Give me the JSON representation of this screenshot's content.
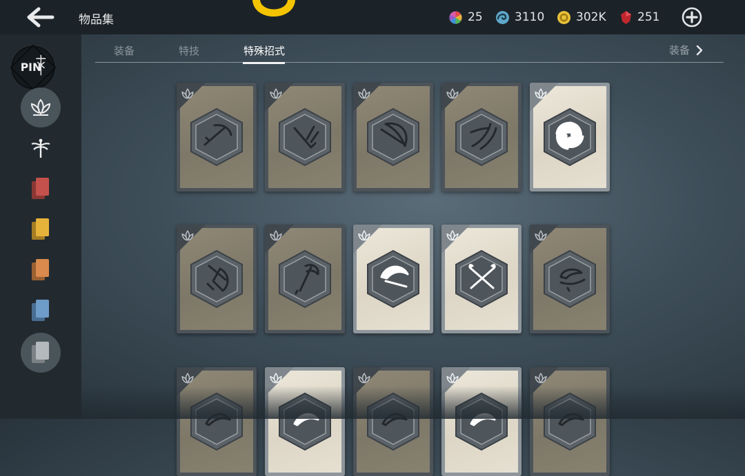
{
  "header": {
    "title": "物品集",
    "back_icon": "back-arrow-icon",
    "emblem_icon": "gold-emblem-icon",
    "resources": [
      {
        "name": "prism",
        "icon": "rainbow-orb-icon",
        "value": "25"
      },
      {
        "name": "spirit",
        "icon": "blue-swirl-icon",
        "value": "3110"
      },
      {
        "name": "coins",
        "icon": "gold-coin-icon",
        "value": "302K"
      },
      {
        "name": "gems",
        "icon": "red-gem-icon",
        "value": "251"
      }
    ],
    "add_icon": "plus-circle-icon"
  },
  "sidebar": {
    "items": [
      {
        "icon": "pin-badge-icon",
        "label": "PIN"
      },
      {
        "icon": "lotus-icon",
        "active": true
      },
      {
        "icon": "dragonfly-icon"
      },
      {
        "icon": "red-cards-icon",
        "color": "#c4514c"
      },
      {
        "icon": "yellow-cards-icon",
        "color": "#e6b33a"
      },
      {
        "icon": "orange-cards-icon",
        "color": "#d98a4c"
      },
      {
        "icon": "blue-cards-icon",
        "color": "#6e9cc9"
      },
      {
        "icon": "gray-cards-icon",
        "color": "#b4b9bd"
      }
    ]
  },
  "tabs": {
    "items": [
      "装备",
      "特技",
      "特殊招式"
    ],
    "selected": "特殊招式",
    "next_label": "装备"
  },
  "cards": [
    {
      "icon": "curved-blade-icon",
      "owned": false
    },
    {
      "icon": "knife-slash-icon",
      "owned": false
    },
    {
      "icon": "crescent-sword-icon",
      "owned": false
    },
    {
      "icon": "twin-blade-icon",
      "owned": false
    },
    {
      "icon": "shuriken-icon",
      "owned": true
    },
    {
      "icon": "cleaver-icon",
      "owned": false
    },
    {
      "icon": "kama-icon",
      "owned": false
    },
    {
      "icon": "arc-slash-icon",
      "owned": true
    },
    {
      "icon": "crossed-swords-icon",
      "owned": true
    },
    {
      "icon": "kusarigama-icon",
      "owned": false
    },
    {
      "icon": "blade-icon",
      "owned": false
    },
    {
      "icon": "blade-icon",
      "owned": true
    },
    {
      "icon": "blade-icon",
      "owned": false
    },
    {
      "icon": "blade-icon",
      "owned": true
    },
    {
      "icon": "blade-icon",
      "owned": false
    }
  ],
  "colors": {
    "topbar": "#1c2328",
    "sidebar": "#222a30",
    "gold": "#f5c400",
    "card_unowned": "#7e7868",
    "card_owned": "#e6e0d2"
  }
}
